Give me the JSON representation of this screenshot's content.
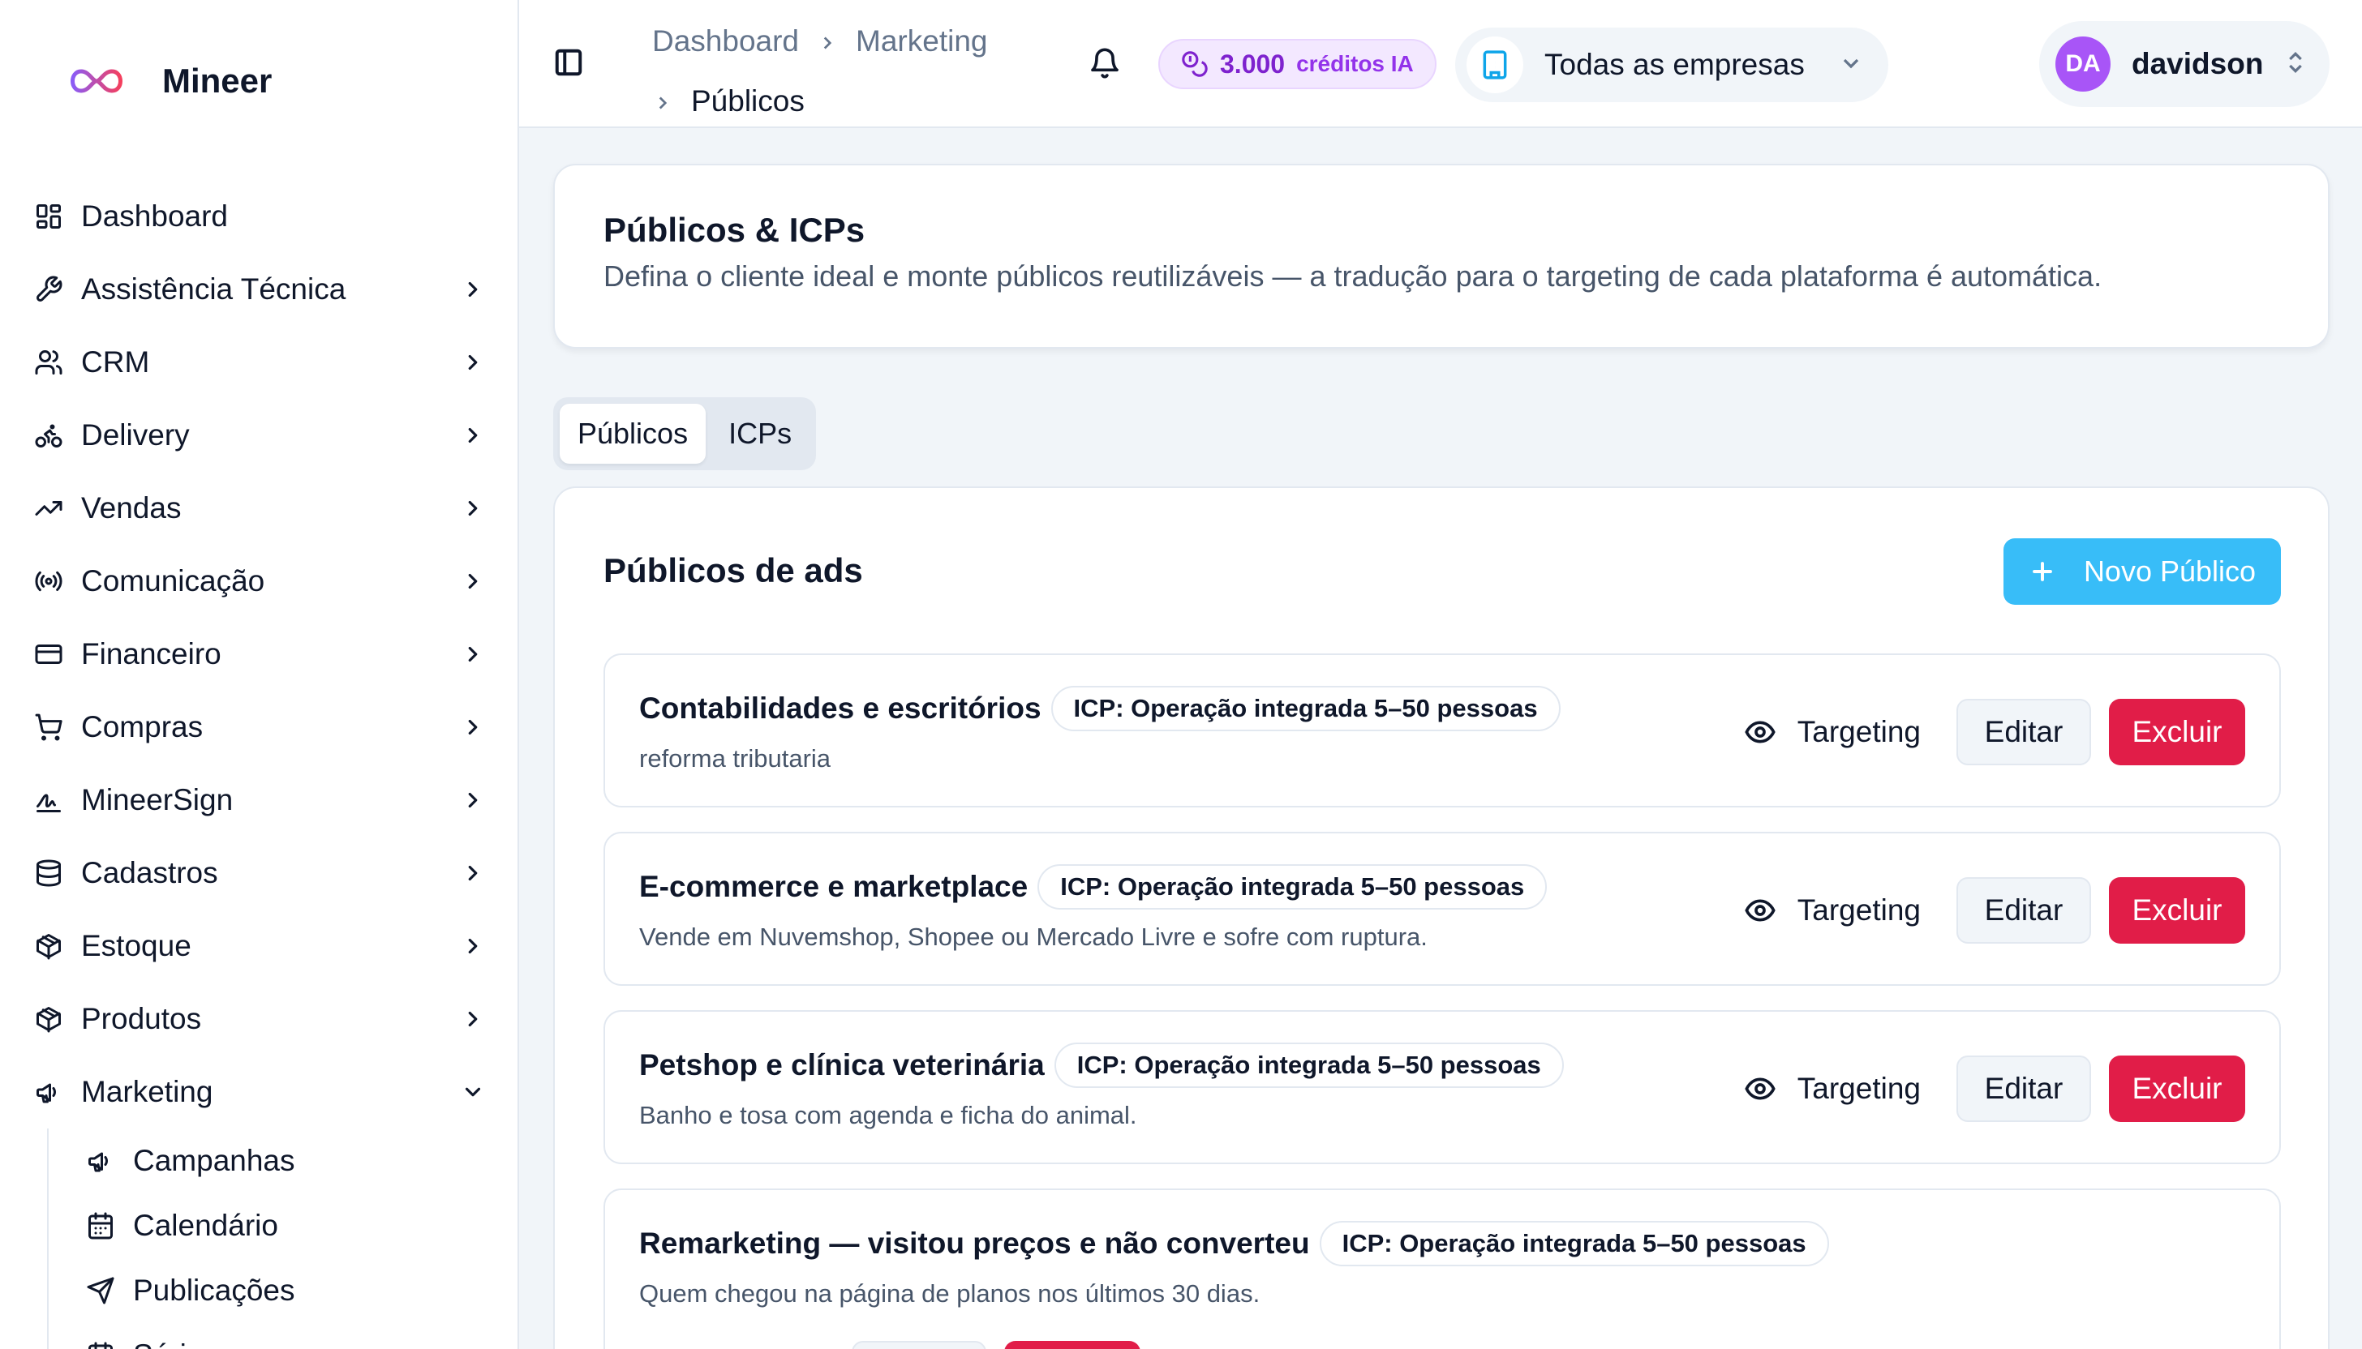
{
  "brand": {
    "name": "Mineer",
    "logo_icon": "infinity-logo-icon",
    "logo_colors": [
      "#f43f5e",
      "#8b5cf6"
    ]
  },
  "sidebar": {
    "items": [
      {
        "label": "Dashboard",
        "icon": "layout-grid-icon",
        "has_children": false
      },
      {
        "label": "Assistência Técnica",
        "icon": "wrench-icon",
        "has_children": true
      },
      {
        "label": "CRM",
        "icon": "users-icon",
        "has_children": true
      },
      {
        "label": "Delivery",
        "icon": "bike-icon",
        "has_children": true
      },
      {
        "label": "Vendas",
        "icon": "trending-up-icon",
        "has_children": true
      },
      {
        "label": "Comunicação",
        "icon": "radio-icon",
        "has_children": true
      },
      {
        "label": "Financeiro",
        "icon": "credit-card-icon",
        "has_children": true
      },
      {
        "label": "Compras",
        "icon": "shopping-cart-icon",
        "has_children": true
      },
      {
        "label": "MineerSign",
        "icon": "signature-icon",
        "has_children": true
      },
      {
        "label": "Cadastros",
        "icon": "database-icon",
        "has_children": true
      },
      {
        "label": "Estoque",
        "icon": "package-icon",
        "has_children": true
      },
      {
        "label": "Produtos",
        "icon": "package-icon",
        "has_children": true
      },
      {
        "label": "Marketing",
        "icon": "megaphone-icon",
        "has_children": true,
        "expanded": true
      }
    ],
    "marketing_sub": [
      {
        "label": "Campanhas",
        "icon": "megaphone-icon"
      },
      {
        "label": "Calendário",
        "icon": "calendar-icon"
      },
      {
        "label": "Publicações",
        "icon": "send-icon"
      },
      {
        "label": "Séries",
        "icon": "calendar-range-icon"
      }
    ]
  },
  "topbar": {
    "breadcrumb": [
      "Dashboard",
      "Marketing",
      "Públicos"
    ],
    "credits_value": "3.000",
    "credits_label": "créditos IA",
    "company_selector": "Todas as empresas",
    "user_initials": "DA",
    "user_name": "davidson"
  },
  "header": {
    "title": "Públicos & ICPs",
    "subtitle": "Defina o cliente ideal e monte públicos reutilizáveis — a tradução para o targeting de cada plataforma é automática."
  },
  "tabs": [
    {
      "label": "Públicos",
      "active": true
    },
    {
      "label": "ICPs",
      "active": false
    }
  ],
  "audiences_section": {
    "title": "Públicos de ads",
    "new_button": "Novo Público",
    "targeting_label": "Targeting",
    "edit_label": "Editar",
    "delete_label": "Excluir",
    "items": [
      {
        "name": "Contabilidades e escritórios",
        "icp": "ICP: Operação integrada 5–50 pessoas",
        "description": "reforma tributaria"
      },
      {
        "name": "E-commerce e marketplace",
        "icp": "ICP: Operação integrada 5–50 pessoas",
        "description": "Vende em Nuvemshop, Shopee ou Mercado Livre e sofre com ruptura."
      },
      {
        "name": "Petshop e clínica veterinária",
        "icp": "ICP: Operação integrada 5–50 pessoas",
        "description": "Banho e tosa com agenda e ficha do animal."
      },
      {
        "name": "Remarketing — visitou preços e não converteu",
        "icp": "ICP: Operação integrada 5–50 pessoas",
        "description": "Quem chegou na página de planos nos últimos 30 dias."
      }
    ]
  },
  "colors": {
    "accent": "#38bdf8",
    "danger": "#e11d48",
    "credits": "#7e22ce",
    "avatar": "#a855f7"
  }
}
